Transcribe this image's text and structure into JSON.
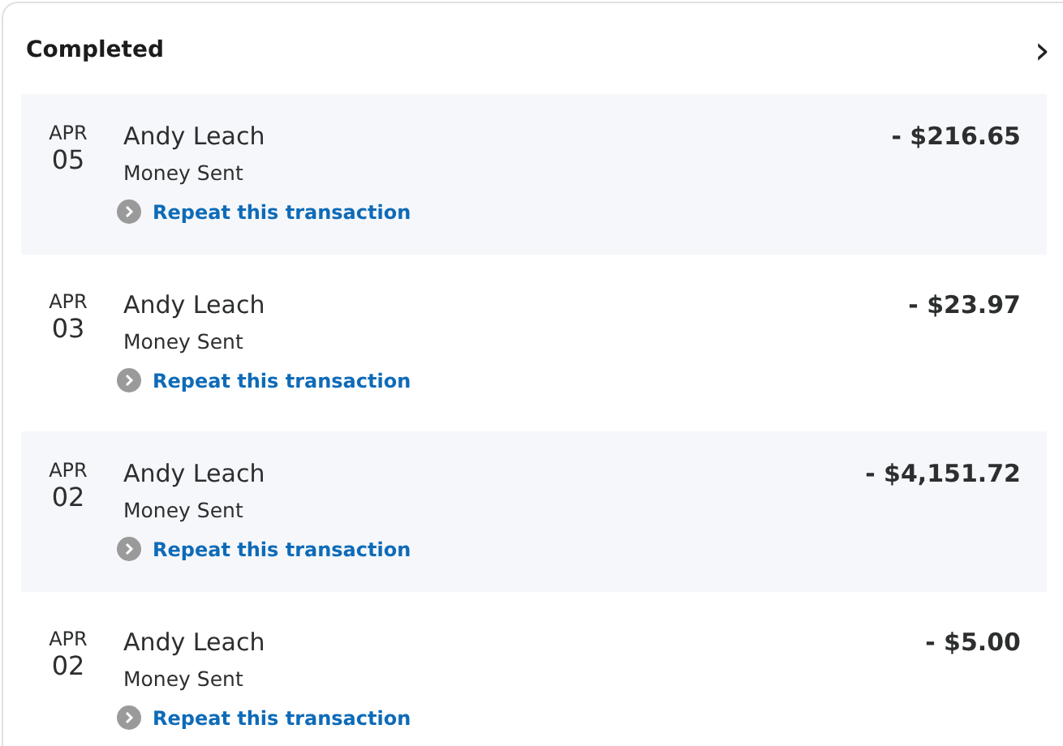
{
  "section": {
    "title": "Completed",
    "chevron": "›"
  },
  "transactions": [
    {
      "month": "APR",
      "day": "05",
      "name": "Andy Leach",
      "type": "Money Sent",
      "action": "Repeat this transaction",
      "amount": "- $216.65"
    },
    {
      "month": "APR",
      "day": "03",
      "name": "Andy Leach",
      "type": "Money Sent",
      "action": "Repeat this transaction",
      "amount": "- $23.97"
    },
    {
      "month": "APR",
      "day": "02",
      "name": "Andy Leach",
      "type": "Money Sent",
      "action": "Repeat this transaction",
      "amount": "- $4,151.72"
    },
    {
      "month": "APR",
      "day": "02",
      "name": "Andy Leach",
      "type": "Money Sent",
      "action": "Repeat this transaction",
      "amount": "- $5.00"
    }
  ]
}
